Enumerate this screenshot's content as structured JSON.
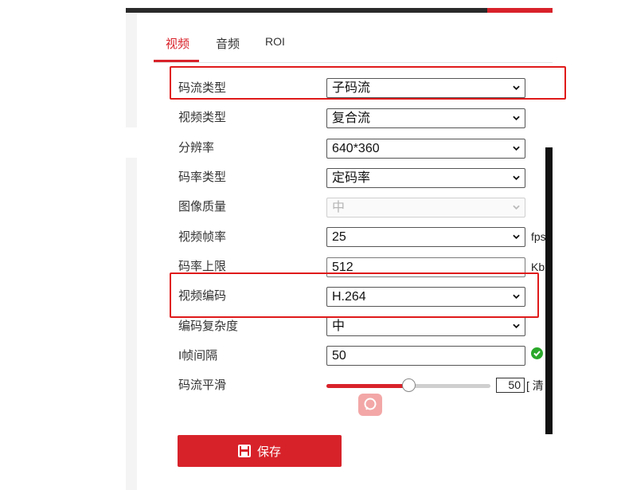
{
  "tabs": [
    {
      "label": "视频"
    },
    {
      "label": "音频"
    },
    {
      "label": "ROI"
    }
  ],
  "active_tab": "视频",
  "form": {
    "stream_type": {
      "label": "码流类型",
      "value": "子码流"
    },
    "video_type": {
      "label": "视频类型",
      "value": "复合流"
    },
    "resolution": {
      "label": "分辨率",
      "value": "640*360"
    },
    "bitrate_type": {
      "label": "码率类型",
      "value": "定码率"
    },
    "image_quality": {
      "label": "图像质量",
      "value": "中"
    },
    "frame_rate": {
      "label": "视频帧率",
      "value": "25",
      "unit": "fps"
    },
    "max_bitrate": {
      "label": "码率上限",
      "value": "512",
      "unit": "Kb"
    },
    "video_encoding": {
      "label": "视频编码",
      "value": "H.264"
    },
    "encoding_complexity": {
      "label": "编码复杂度",
      "value": "中"
    },
    "i_frame_interval": {
      "label": "I帧间隔",
      "value": "50"
    },
    "stream_smoothing": {
      "label": "码流平滑",
      "value": "50",
      "value_fraction": 0.5,
      "suffix": "[ 清"
    }
  },
  "save_label": "保存",
  "colors": {
    "accent": "#d8222a",
    "highlight": "#e01a1a",
    "ok": "#2aa82a"
  },
  "icons": [
    "chevron-down-icon",
    "check-circle-icon",
    "search-icon",
    "save-icon"
  ]
}
